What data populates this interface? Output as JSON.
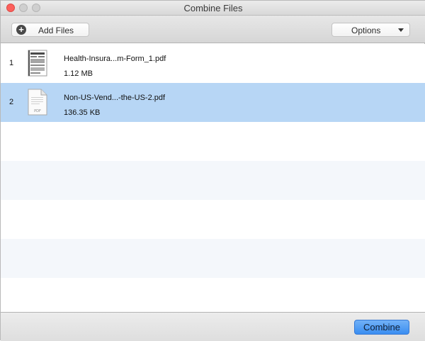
{
  "window": {
    "title": "Combine Files"
  },
  "toolbar": {
    "add_files_label": "Add Files",
    "options_label": "Options",
    "add_icon": "plus-circle-icon",
    "options_icon": "chevron-down-icon"
  },
  "files": [
    {
      "index": "1",
      "name": "Health-Insura...m-Form_1.pdf",
      "size": "1.12 MB",
      "icon": "pdf-document-thumbnail",
      "selected": false
    },
    {
      "index": "2",
      "name": "Non-US-Vend...-the-US-2.pdf",
      "size": "136.35 KB",
      "icon": "pdf-file-icon",
      "selected": true
    }
  ],
  "footer": {
    "combine_label": "Combine"
  },
  "colors": {
    "selection": "#b7d6f5",
    "alt_row": "#f4f7fb",
    "primary_button": "#3a8ef1",
    "close_button": "#fc605c"
  }
}
